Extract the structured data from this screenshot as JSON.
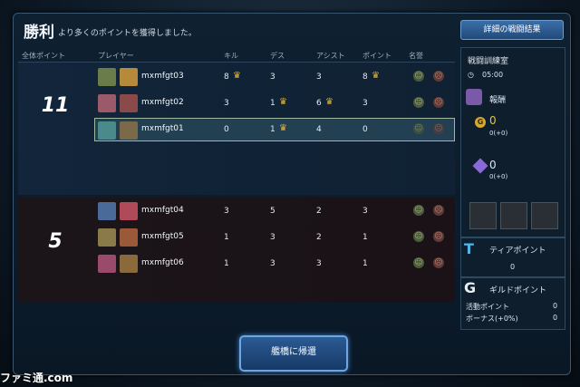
{
  "header": {
    "title": "勝利",
    "subtitle": "より多くのポイントを獲得しました。",
    "detail_button": "詳細の戦闘結果"
  },
  "columns": {
    "total_points": "全体ポイント",
    "player": "プレイヤー",
    "kill": "キル",
    "death": "デス",
    "assist": "アシスト",
    "point": "ポイント",
    "honor": "名誉"
  },
  "team1": {
    "score": "11",
    "players": [
      {
        "name": "mxmfgt03",
        "kill": "8",
        "kill_crown": true,
        "death": "3",
        "death_crown": false,
        "assist": "3",
        "assist_crown": false,
        "point": "8",
        "point_crown": true
      },
      {
        "name": "mxmfgt02",
        "kill": "3",
        "kill_crown": false,
        "death": "1",
        "death_crown": true,
        "assist": "6",
        "assist_crown": true,
        "point": "3",
        "point_crown": false
      },
      {
        "name": "mxmfgt01",
        "kill": "0",
        "kill_crown": false,
        "death": "1",
        "death_crown": true,
        "assist": "4",
        "assist_crown": false,
        "point": "0",
        "point_crown": false
      }
    ]
  },
  "team2": {
    "score": "5",
    "players": [
      {
        "name": "mxmfgt04",
        "kill": "3",
        "death": "5",
        "assist": "2",
        "point": "3"
      },
      {
        "name": "mxmfgt05",
        "kill": "1",
        "death": "3",
        "assist": "2",
        "point": "1"
      },
      {
        "name": "mxmfgt06",
        "kill": "1",
        "death": "3",
        "assist": "3",
        "point": "1"
      }
    ]
  },
  "side": {
    "room": "戦闘訓練室",
    "time": "05:00",
    "reward_title": "報酬",
    "gold_value": "0",
    "gold_sub": "0(+0)",
    "crystal_value": "0",
    "crystal_sub": "0(+0)",
    "tier_title": "ティアポイント",
    "tier_value": "0",
    "guild_title": "ギルドポイント",
    "activity_label": "活動ポイント",
    "activity_value": "0",
    "bonus_label": "ボーナス(+0%)",
    "bonus_value": "0"
  },
  "footer": {
    "return_button": "艦橋に帰還",
    "watermark": "ファミ通.com"
  },
  "colors": {
    "accent": "#3b6fa8",
    "crown": "#e0b43a"
  }
}
